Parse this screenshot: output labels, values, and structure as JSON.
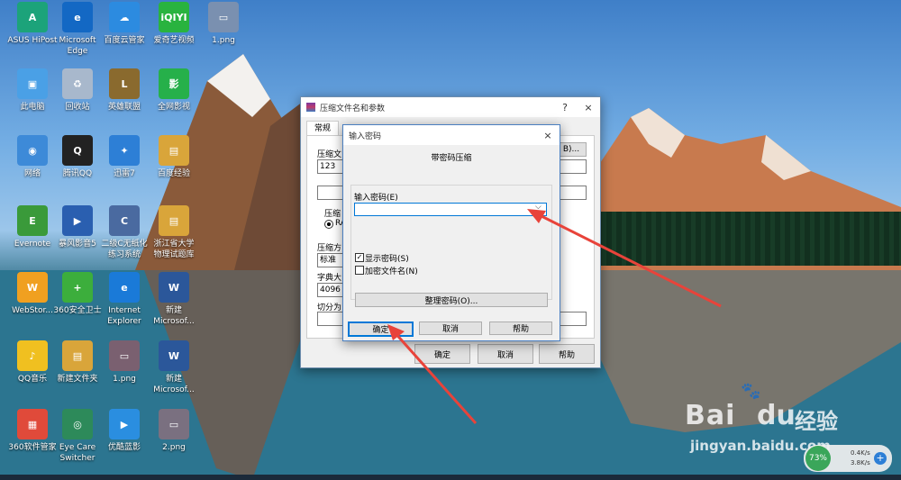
{
  "desktop_icons": [
    {
      "label": "ASUS HiPost",
      "label2": "",
      "color": "#1ca37a",
      "glyph": "A"
    },
    {
      "label": "Microsoft",
      "label2": "Edge",
      "color": "#1368c4",
      "glyph": "e"
    },
    {
      "label": "百度云管家",
      "label2": "",
      "color": "#2c8be0",
      "glyph": "☁"
    },
    {
      "label": "爱奇艺视频",
      "label2": "",
      "color": "#29b33f",
      "glyph": "iQIYI"
    },
    {
      "label": "1.png",
      "label2": "",
      "color": "#7a90b0",
      "glyph": "▭"
    },
    {
      "label": "此电脑",
      "label2": "",
      "color": "#4aa0e6",
      "glyph": "▣"
    },
    {
      "label": "回收站",
      "label2": "",
      "color": "#a8b8cc",
      "glyph": "♻"
    },
    {
      "label": "英雄联盟",
      "label2": "",
      "color": "#8a6a2e",
      "glyph": "L"
    },
    {
      "label": "全网影视",
      "label2": "",
      "color": "#26b04a",
      "glyph": "影"
    },
    {
      "label": "网络",
      "label2": "",
      "color": "#3d8ad8",
      "glyph": "◉"
    },
    {
      "label": "腾讯QQ",
      "label2": "",
      "color": "#222",
      "glyph": "Q"
    },
    {
      "label": "迅雷7",
      "label2": "",
      "color": "#2d7fd6",
      "glyph": "✦"
    },
    {
      "label": "百度经验",
      "label2": "",
      "color": "#d9a53a",
      "glyph": "▤"
    },
    {
      "label": "Evernote",
      "label2": "",
      "color": "#3a9a3a",
      "glyph": "E"
    },
    {
      "label": "暴风影音5",
      "label2": "",
      "color": "#2a5fb0",
      "glyph": "▶"
    },
    {
      "label": "二级C无纸化",
      "label2": "练习系统",
      "color": "#4a6aa0",
      "glyph": "C"
    },
    {
      "label": "浙江省大学",
      "label2": "物理试题库",
      "color": "#d9a53a",
      "glyph": "▤"
    },
    {
      "label": "WebStor...",
      "label2": "",
      "color": "#f0a020",
      "glyph": "W"
    },
    {
      "label": "360安全卫士",
      "label2": "",
      "color": "#3cae3c",
      "glyph": "+"
    },
    {
      "label": "Internet",
      "label2": "Explorer",
      "color": "#1a7ad8",
      "glyph": "e"
    },
    {
      "label": "新建",
      "label2": "Microsof...",
      "color": "#2b579a",
      "glyph": "W"
    },
    {
      "label": "QQ音乐",
      "label2": "",
      "color": "#f0c020",
      "glyph": "♪"
    },
    {
      "label": "新建文件夹",
      "label2": "",
      "color": "#d9a53a",
      "glyph": "▤"
    },
    {
      "label": "1.png",
      "label2": "",
      "color": "#7a6070",
      "glyph": "▭"
    },
    {
      "label": "新建",
      "label2": "Microsof...",
      "color": "#2b579a",
      "glyph": "W"
    },
    {
      "label": "360软件管家",
      "label2": "",
      "color": "#e04a3a",
      "glyph": "▦"
    },
    {
      "label": "Eye Care",
      "label2": "Switcher",
      "color": "#2d8a5a",
      "glyph": "◎"
    },
    {
      "label": "优酷蓝影",
      "label2": "",
      "color": "#2a8ee0",
      "glyph": "▶"
    },
    {
      "label": "2.png",
      "label2": "",
      "color": "#7a7080",
      "glyph": "▭"
    }
  ],
  "back_window": {
    "title": "压缩文件名和参数",
    "help_glyph": "?",
    "close_glyph": "×",
    "tab_general": "常规",
    "archive_name_label": "压缩文",
    "archive_name_value": "123",
    "browse_label": "B)...",
    "format_label": "压缩",
    "format_option": "RA",
    "method_label": "压缩方",
    "method_value": "标准",
    "dict_label": "字典大",
    "dict_value": "4096",
    "split_label": "切分为",
    "ok": "确定",
    "cancel": "取消",
    "help": "帮助"
  },
  "password_dialog": {
    "title": "输入密码",
    "close_glyph": "×",
    "heading": "带密码压缩",
    "group_label": "输入密码(E)",
    "password_value": "",
    "show_password_label": "显示密码(S)",
    "show_password_checked": true,
    "encrypt_names_label": "加密文件名(N)",
    "encrypt_names_checked": false,
    "organize_button": "整理密码(O)...",
    "ok": "确定",
    "cancel": "取消",
    "help": "帮助"
  },
  "tray": {
    "percent": "73%",
    "upload": "0.4K/s",
    "download": "3.8K/s"
  },
  "watermark": {
    "brand": "Bai",
    "brand2": "du",
    "jingyan": "经验",
    "url": "jingyan.baidu.com"
  }
}
